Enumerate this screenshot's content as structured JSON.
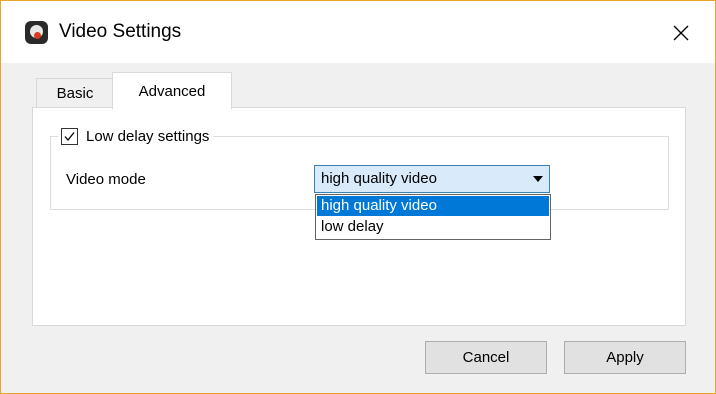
{
  "window": {
    "title": "Video Settings",
    "icons": {
      "app": "app-logo-icon",
      "close": "close-icon"
    }
  },
  "tabs": [
    {
      "label": "Basic",
      "active": false
    },
    {
      "label": "Advanced",
      "active": true
    }
  ],
  "group": {
    "checkbox_label": "Low delay settings",
    "checked": true
  },
  "video_mode": {
    "label": "Video mode",
    "selected": "high quality video",
    "options": [
      "high quality video",
      "low delay"
    ]
  },
  "buttons": {
    "cancel": "Cancel",
    "apply": "Apply"
  },
  "colors": {
    "window_border": "#e7a629",
    "selection": "#0078d7",
    "combo_bg": "#d9eafa",
    "combo_border": "#3c7fb1"
  }
}
